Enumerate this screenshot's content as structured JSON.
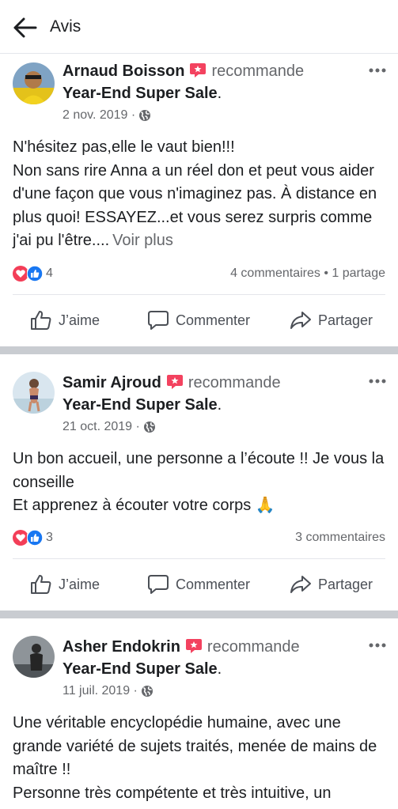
{
  "header": {
    "title": "Avis"
  },
  "actions": {
    "like": "J’aime",
    "comment": "Commenter",
    "share": "Partager"
  },
  "posts": [
    {
      "author": "Arnaud Boisson",
      "verb": "recommande",
      "page": "Year-End Super Sale",
      "date": "2 nov. 2019 ·",
      "body": [
        "N'hésitez pas,elle le vaut bien!!!",
        "Non sans rire Anna a un réel don et peut vous aider d'une façon que vous n'imaginez pas. À distance en plus quoi! ESSAYEZ...et vous serez surpris comme j'ai pu l'être...."
      ],
      "see_more": "Voir plus",
      "reactions_count": "4",
      "stats_right": "4 commentaires • 1 partage"
    },
    {
      "author": "Samir Ajroud",
      "verb": "recommande",
      "page": "Year-End Super Sale",
      "date": "21 oct. 2019 ·",
      "body": [
        "Un bon accueil, une personne a l’écoute !! Je vous la conseille",
        "Et apprenez à écouter votre corps 🙏"
      ],
      "reactions_count": "3",
      "stats_right": "3 commentaires"
    },
    {
      "author": "Asher Endokrin",
      "verb": "recommande",
      "page": "Year-End Super Sale",
      "date": "11 juil. 2019 ·",
      "body": [
        "Une véritable encyclopédie humaine, avec une grande variété de sujets traités, menée de mains de maître !!",
        "Personne très compétente et très intuitive, un"
      ]
    }
  ],
  "colors": {
    "love": "#f33e58",
    "like": "#1877f2",
    "recommend_badge": "#f3425f",
    "separator": "#c9ccd1"
  },
  "icons": {
    "back": "arrow-left-icon",
    "more": "more-horizontal-icon",
    "globe": "globe-icon",
    "recommend": "recommend-badge-icon",
    "like": "thumbs-up-icon",
    "comment": "comment-bubble-icon",
    "share": "share-arrow-icon"
  }
}
